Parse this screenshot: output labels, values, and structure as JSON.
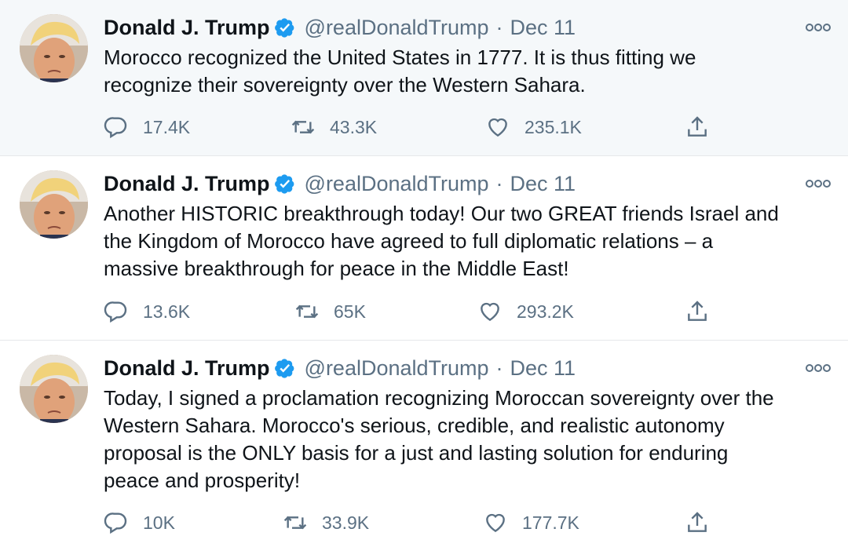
{
  "tweets": [
    {
      "author_name": "Donald J. Trump",
      "handle": "@realDonaldTrump",
      "separator": "·",
      "date": "Dec 11",
      "text": "Morocco recognized the United States in 1777.  It is thus fitting we\nrecognize their sovereignty over the Western Sahara.",
      "replies": "17.4K",
      "retweets": "43.3K",
      "likes": "235.1K"
    },
    {
      "author_name": "Donald J. Trump",
      "handle": "@realDonaldTrump",
      "separator": "·",
      "date": "Dec 11",
      "text": "Another HISTORIC breakthrough today! Our two GREAT friends Israel and\nthe Kingdom of Morocco have agreed to full diplomatic relations – a\nmassive breakthrough for peace in the Middle East!",
      "replies": "13.6K",
      "retweets": "65K",
      "likes": "293.2K"
    },
    {
      "author_name": "Donald J. Trump",
      "handle": "@realDonaldTrump",
      "separator": "·",
      "date": "Dec 11",
      "text": "Today, I signed a proclamation recognizing Moroccan sovereignty over the\nWestern Sahara.  Morocco's serious, credible, and realistic autonomy\nproposal is the ONLY basis for a just and lasting solution for enduring\npeace and prosperity!",
      "replies": "10K",
      "retweets": "33.9K",
      "likes": "177.7K"
    }
  ],
  "icons": {
    "verified": "verified-badge-icon",
    "more": "more-options-icon",
    "reply": "reply-icon",
    "retweet": "retweet-icon",
    "like": "heart-icon",
    "share": "share-icon"
  },
  "colors": {
    "verified_blue": "#1d9bf0",
    "secondary_text": "#5b7083",
    "highlight_bg": "#f5f8fa"
  }
}
